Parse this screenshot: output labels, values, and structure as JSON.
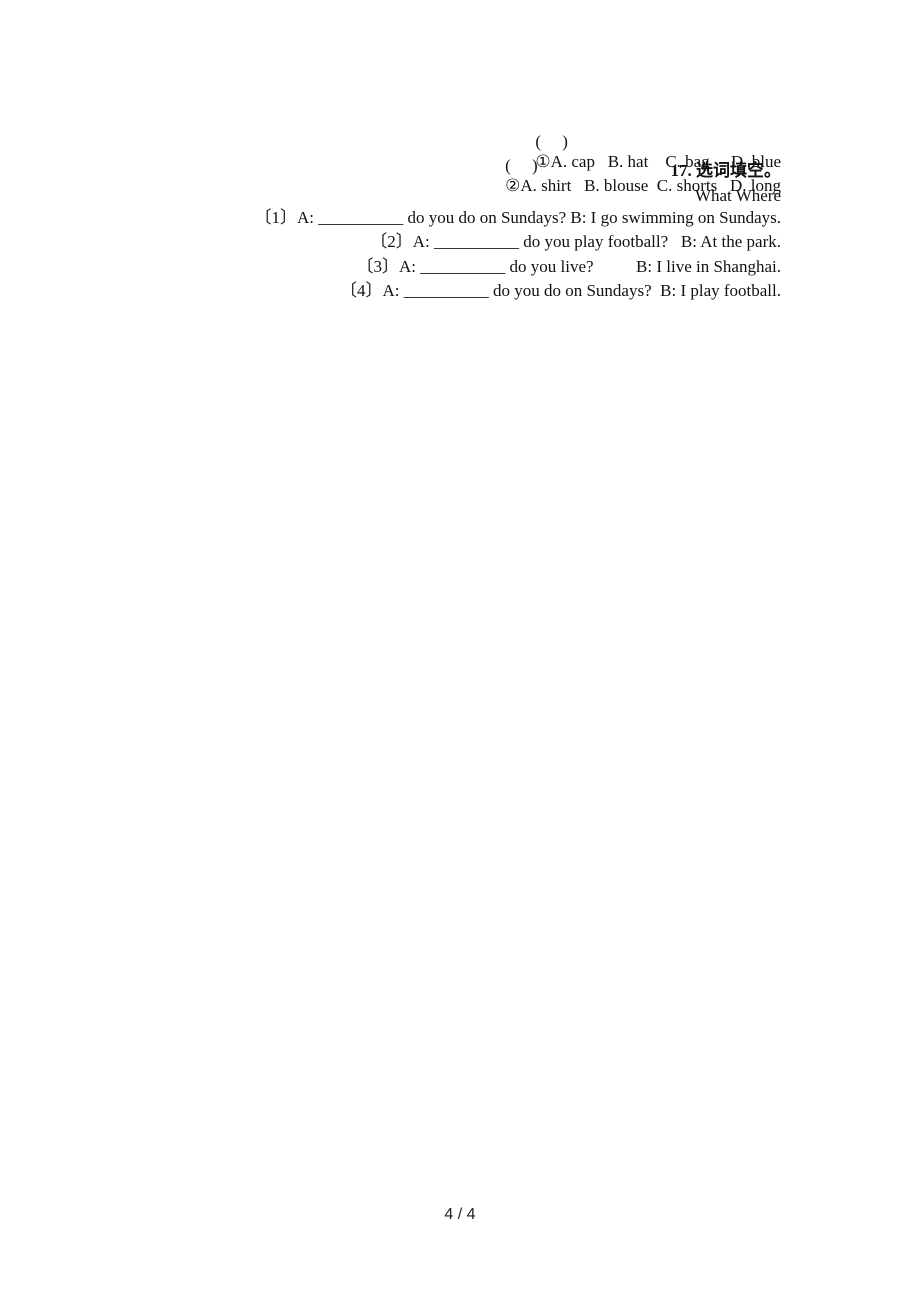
{
  "questions": [
    {
      "paren": "(     )",
      "num": "①",
      "options": "A. cap   B. hat    C. bag     D. blue"
    },
    {
      "paren": "(     )",
      "num": "②",
      "options": "A. shirt   B. blouse  C. shorts   D. long"
    }
  ],
  "section17": {
    "title": "17. 选词填空。",
    "word_bank": "What Where",
    "items": [
      {
        "label": "〔1〕A: __________ do you do on Sundays? B: I go swimming on Sundays."
      },
      {
        "label": "〔2〕A: __________ do you play football?   B: At the park."
      },
      {
        "label": "〔3〕A: __________ do you live?          B: I live in Shanghai."
      },
      {
        "label": "〔4〕A: __________ do you do on Sundays?  B: I play football."
      }
    ]
  },
  "footer": {
    "page": "4 / 4"
  }
}
